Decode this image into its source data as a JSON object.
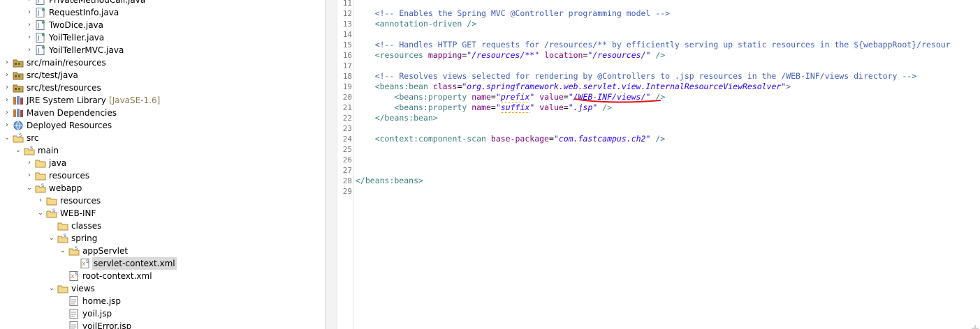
{
  "tree": {
    "items": [
      {
        "label": "PrivateMethodCall.java",
        "type": "java",
        "twisty": ">",
        "depth": 2
      },
      {
        "label": "RequestInfo.java",
        "type": "java",
        "twisty": ">",
        "depth": 2
      },
      {
        "label": "TwoDice.java",
        "type": "java",
        "twisty": ">",
        "depth": 2
      },
      {
        "label": "YoilTeller.java",
        "type": "java",
        "twisty": ">",
        "depth": 2
      },
      {
        "label": "YoilTellerMVC.java",
        "type": "java",
        "twisty": ">",
        "depth": 2
      },
      {
        "label": "src/main/resources",
        "type": "srcfolder",
        "twisty": ">",
        "depth": 0
      },
      {
        "label": "src/test/java",
        "type": "srcfolder",
        "twisty": ">",
        "depth": 0
      },
      {
        "label": "src/test/resources",
        "type": "srcfolder",
        "twisty": ">",
        "depth": 0
      },
      {
        "label": "JRE System Library",
        "decoration": "[JavaSE-1.6]",
        "type": "library",
        "twisty": ">",
        "depth": 0
      },
      {
        "label": "Maven Dependencies",
        "type": "library",
        "twisty": ">",
        "depth": 0
      },
      {
        "label": "Deployed Resources",
        "type": "deployed",
        "twisty": ">",
        "depth": 0
      },
      {
        "label": "src",
        "type": "folder-s",
        "twisty": "v",
        "depth": 0
      },
      {
        "label": "main",
        "type": "folder-s",
        "twisty": "v",
        "depth": 1
      },
      {
        "label": "java",
        "type": "folder",
        "twisty": ">",
        "depth": 2
      },
      {
        "label": "resources",
        "type": "folder",
        "twisty": ">",
        "depth": 2
      },
      {
        "label": "webapp",
        "type": "folder-s",
        "twisty": "v",
        "depth": 2
      },
      {
        "label": "resources",
        "type": "folder",
        "twisty": ">",
        "depth": 3
      },
      {
        "label": "WEB-INF",
        "type": "folder-s",
        "twisty": "v",
        "depth": 3
      },
      {
        "label": "classes",
        "type": "folder",
        "twisty": "",
        "depth": 4
      },
      {
        "label": "spring",
        "type": "folder-s",
        "twisty": "v",
        "depth": 4
      },
      {
        "label": "appServlet",
        "type": "folder-s",
        "twisty": "v",
        "depth": 5
      },
      {
        "label": "servlet-context.xml",
        "type": "xml",
        "twisty": "",
        "depth": 6,
        "selected": true
      },
      {
        "label": "root-context.xml",
        "type": "xml",
        "twisty": "",
        "depth": 5
      },
      {
        "label": "views",
        "type": "folder",
        "twisty": "v",
        "depth": 4
      },
      {
        "label": "home.jsp",
        "type": "jsp",
        "twisty": "",
        "depth": 5
      },
      {
        "label": "yoil.jsp",
        "type": "jsp",
        "twisty": "",
        "depth": 5
      },
      {
        "label": "yoilError.jsp",
        "type": "jsp",
        "twisty": "",
        "depth": 5
      }
    ]
  },
  "editor": {
    "line_numbers": [
      "11",
      "12",
      "13",
      "14",
      "15",
      "16",
      "17",
      "18",
      "19",
      "20",
      "21",
      "22",
      "23",
      "24",
      "25",
      "26",
      "27",
      "28",
      "29"
    ],
    "fold_marker_line": "19",
    "warning_lines": [
      "20",
      "21"
    ],
    "lines": [
      "",
      "\t<!-- Enables the Spring MVC @Controller programming model -->",
      "\t<annotation-driven />",
      "",
      "\t<!-- Handles HTTP GET requests for /resources/** by efficiently serving up static resources in the ${webappRoot}/resour",
      "\t<resources mapping=\"/resources/**\" location=\"/resources/\" />",
      "",
      "\t<!-- Resolves views selected for rendering by @Controllers to .jsp resources in the /WEB-INF/views directory -->",
      "\t<beans:bean class=\"org.springframework.web.servlet.view.InternalResourceViewResolver\">",
      "\t\t<beans:property name=\"prefix\" value=\"/WEB-INF/views/\" />",
      "\t\t<beans:property name=\"suffix\" value=\".jsp\" />",
      "\t</beans:bean>",
      "",
      "\t<context:component-scan base-package=\"com.fastcampus.ch2\" />",
      "",
      "",
      "",
      "</beans:beans>",
      ""
    ]
  },
  "colors": {
    "comment": "#3f5fbf",
    "tag": "#3f7f7f",
    "attribute": "#7f007f",
    "value": "#2a00ff",
    "annotation_stroke": "#e0141e",
    "selection": "#d9d9d9"
  }
}
